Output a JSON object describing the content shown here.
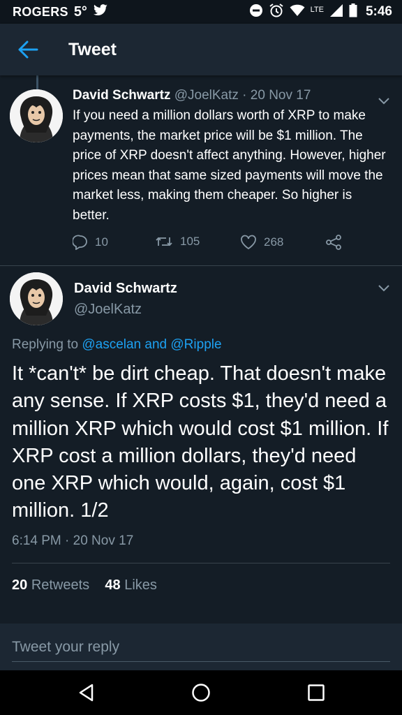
{
  "status_bar": {
    "carrier": "ROGERS",
    "temperature": "5°",
    "network": "LTE",
    "time": "5:46",
    "icons": [
      "twitter-icon",
      "dnd-icon",
      "alarm-icon",
      "wifi-icon",
      "signal-icon",
      "battery-icon"
    ]
  },
  "app_bar": {
    "title": "Tweet",
    "back_icon": "arrow-left-icon",
    "accent_color": "#1da1f2"
  },
  "parent_tweet": {
    "author_name": "David Schwartz",
    "author_handle": "@JoelKatz",
    "separator": "·",
    "date": "20 Nov 17",
    "text": "If you need a million dollars worth of XRP to make payments, the market price will be $1 million. The price of XRP doesn't affect anything. However, higher prices mean that same sized payments will move the market less, making them cheaper. So higher is better.",
    "replies": "10",
    "retweets": "105",
    "likes": "268"
  },
  "main_tweet": {
    "author_name": "David Schwartz",
    "author_handle": "@JoelKatz",
    "replying_prefix": "Replying to",
    "reply_to_1": "@ascelan",
    "reply_and": "and",
    "reply_to_2": "@Ripple",
    "text": "It *can't* be dirt cheap. That doesn't make any sense. If XRP costs $1, they'd need a million XRP which would cost $1 million. If XRP cost a million dollars, they'd need one XRP which would, again, cost $1 million. 1/2",
    "timestamp": "6:14 PM · 20 Nov 17",
    "retweet_count": "20",
    "retweet_label": "Retweets",
    "like_count": "48",
    "like_label": "Likes"
  },
  "reply_box": {
    "placeholder": "Tweet your reply"
  },
  "nav_bar": {
    "buttons": [
      "back-triangle-icon",
      "home-circle-icon",
      "recents-square-icon"
    ]
  },
  "colors": {
    "background": "#141d26",
    "bar": "#1c2733",
    "muted_text": "#8899a6",
    "link": "#1da1f2"
  }
}
